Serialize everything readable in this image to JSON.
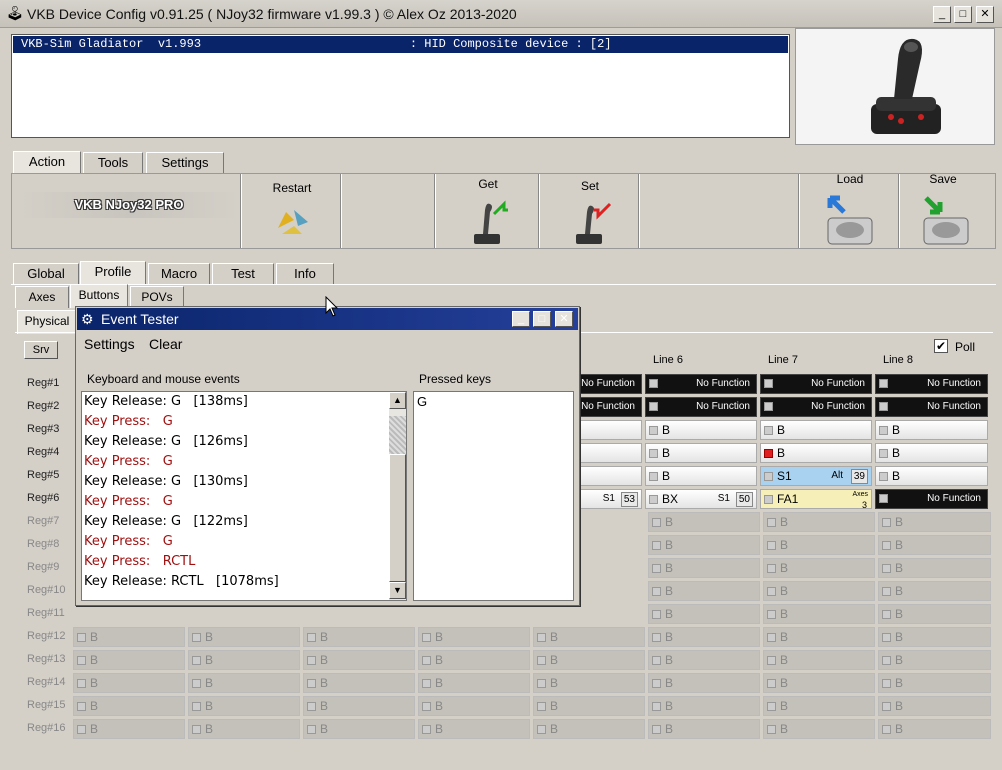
{
  "window": {
    "title": "VKB Device Config v0.91.25 ( NJoy32 firmware v1.99.3 ) © Alex Oz 2013-2020",
    "min": "_",
    "max": "□",
    "close": "✕"
  },
  "device": {
    "selected": "VKB-Sim Gladiator  v1.993                             : HID Composite device : [2]"
  },
  "main_tabs": [
    "Action",
    "Tools",
    "Settings"
  ],
  "action": {
    "firmware": "VKB NJoy32 PRO",
    "restart": "Restart",
    "get": "Get",
    "set": "Set",
    "load": "Load",
    "save": "Save"
  },
  "config_tabs": [
    "Global",
    "Profile",
    "Macro",
    "Test",
    "Info"
  ],
  "sub_tabs": [
    "Axes",
    "Buttons",
    "POVs"
  ],
  "physical_tab": "Physical",
  "srv": "Srv",
  "poll": "Poll",
  "lines": [
    "Line 6",
    "Line 7",
    "Line 8"
  ],
  "regs": [
    "Reg#1",
    "Reg#2",
    "Reg#3",
    "Reg#4",
    "Reg#5",
    "Reg#6",
    "Reg#7",
    "Reg#8",
    "Reg#9",
    "Reg#10",
    "Reg#11",
    "Reg#12",
    "Reg#13",
    "Reg#14",
    "Reg#15",
    "Reg#16"
  ],
  "cells": {
    "no_function": "No Function",
    "b": "B",
    "bx": "BX",
    "s1": "S1",
    "alt": "Alt",
    "n39": "39",
    "n50": "50",
    "n53": "53",
    "fa1": "FA1",
    "axes": "Axes",
    "n3": "3"
  },
  "dialog": {
    "title": "Event Tester",
    "menu": [
      "Settings",
      "Clear"
    ],
    "events_label": "Keyboard and mouse events",
    "pressed_label": "Pressed keys",
    "pressed": "G",
    "events": [
      {
        "t": "Key Release: G   [138ms]",
        "k": "rel"
      },
      {
        "t": "Key Press:   G",
        "k": "press"
      },
      {
        "t": "Key Release: G   [126ms]",
        "k": "rel"
      },
      {
        "t": "Key Press:   G",
        "k": "press"
      },
      {
        "t": "Key Release: G   [130ms]",
        "k": "rel"
      },
      {
        "t": "Key Press:   G",
        "k": "press"
      },
      {
        "t": "Key Release: G   [122ms]",
        "k": "rel"
      },
      {
        "t": "Key Press:   G",
        "k": "press"
      },
      {
        "t": "Key Press:   RCTL",
        "k": "press"
      },
      {
        "t": "Key Release: RCTL   [1078ms]",
        "k": "rel"
      }
    ]
  }
}
